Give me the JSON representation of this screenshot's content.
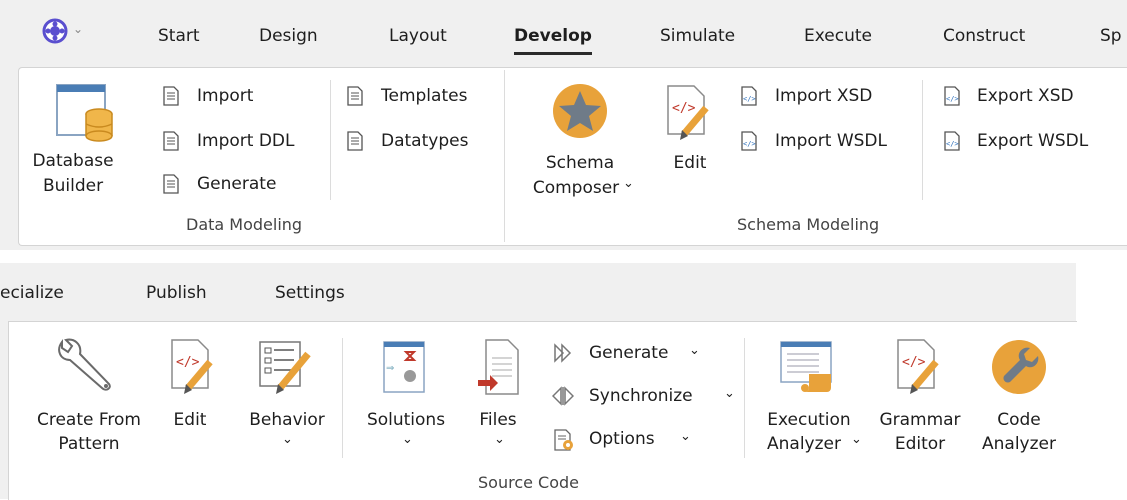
{
  "top": {
    "tabs": [
      "Start",
      "Design",
      "Layout",
      "Develop",
      "Simulate",
      "Execute",
      "Construct",
      "Sp"
    ],
    "data_modeling": {
      "group_label": "Data Modeling",
      "database_builder": [
        "Database",
        "Builder"
      ],
      "import": "Import",
      "import_ddl": "Import DDL",
      "generate": "Generate",
      "templates": "Templates",
      "datatypes": "Datatypes"
    },
    "schema_modeling": {
      "group_label": "Schema Modeling",
      "schema_composer": [
        "Schema",
        "Composer"
      ],
      "edit": "Edit",
      "import_xsd": "Import XSD",
      "import_wsdl": "Import WSDL",
      "export_xsd": "Export XSD",
      "export_wsdl": "Export WSDL"
    }
  },
  "bottom": {
    "tabs": [
      "ecialize",
      "Publish",
      "Settings"
    ],
    "source_code": {
      "group_label": "Source Code",
      "create_from_pattern": [
        "Create From",
        "Pattern"
      ],
      "edit": "Edit",
      "behavior": "Behavior",
      "solutions": "Solutions",
      "files": "Files",
      "generate": "Generate",
      "synchronize": "Synchronize",
      "options": "Options",
      "execution_analyzer": [
        "Execution",
        "Analyzer"
      ],
      "grammar_editor": [
        "Grammar",
        "Editor"
      ],
      "code_analyzer": [
        "Code",
        "Analyzer"
      ]
    }
  },
  "icons": {
    "app_menu": "app-logo-icon",
    "database_builder": "database-builder-icon",
    "doc": "document-icon",
    "schema_composer": "star-badge-icon",
    "edit": "code-pencil-icon",
    "xsd": "xml-document-icon",
    "create_from_pattern": "wrench-icon",
    "behavior": "behavior-edit-icon",
    "solutions": "solutions-icon",
    "files": "files-icon",
    "generate": "generate-arrow-icon",
    "synchronize": "synchronize-icon",
    "options": "options-icon",
    "execution_analyzer": "execution-analyzer-icon",
    "code_analyzer": "code-analyzer-icon"
  },
  "colors": {
    "accent_orange": "#e8a23a",
    "logo_purple": "#5a4fcf",
    "tab_strip": "#f0f0f0"
  }
}
